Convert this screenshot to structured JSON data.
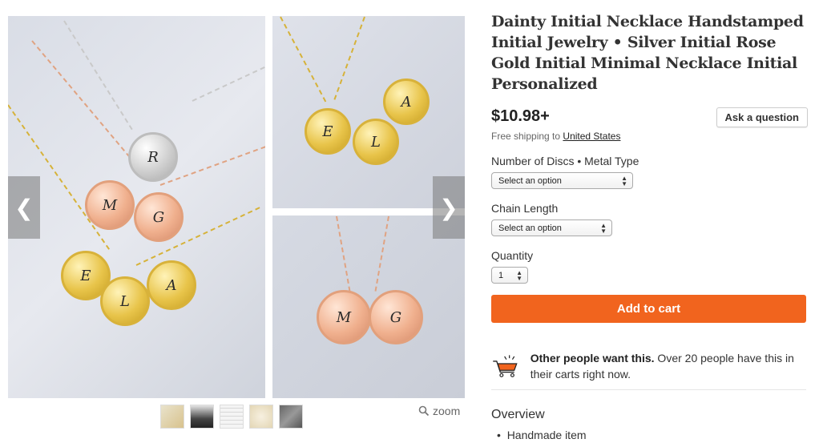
{
  "listing": {
    "title": "Dainty Initial Necklace Handstamped Initial Jewelry • Silver Initial Rose Gold Initial Minimal Necklace Initial Personalized",
    "price": "$10.98+",
    "ask_button": "Ask a question",
    "shipping_prefix": "Free shipping to",
    "shipping_dest": "United States"
  },
  "options": {
    "discs_label": "Number of Discs • Metal Type",
    "discs_value": "Select an option",
    "chain_label": "Chain Length",
    "chain_value": "Select an option",
    "quantity_label": "Quantity",
    "quantity_value": "1"
  },
  "cart": {
    "add_label": "Add to cart"
  },
  "demand": {
    "bold": "Other people want this.",
    "rest": " Over 20 people have this in their carts right now."
  },
  "overview": {
    "heading": "Overview",
    "items": [
      "Handmade item"
    ]
  },
  "gallery": {
    "zoom_label": "zoom",
    "prev_icon": "chevron-left-icon",
    "next_icon": "chevron-right-icon",
    "main_discs": [
      "R",
      "M",
      "G",
      "E",
      "L",
      "A"
    ],
    "side_top_discs": [
      "E",
      "L",
      "A"
    ],
    "side_bottom_discs": [
      "M",
      "G"
    ]
  },
  "colors": {
    "accent": "#f1641e"
  }
}
